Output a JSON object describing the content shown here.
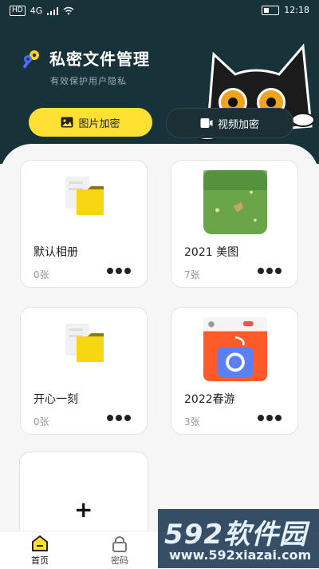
{
  "status_bar": {
    "network": "HD",
    "signal_text": "4G",
    "time": "12:18"
  },
  "header": {
    "title": "私密文件管理",
    "subtitle": "有效保护用户隐私"
  },
  "tabs": [
    {
      "label": "图片加密",
      "icon": "image-icon"
    },
    {
      "label": "视频加密",
      "icon": "video-icon"
    }
  ],
  "albums": [
    {
      "name": "默认相册",
      "count": "0张",
      "thumb": "folder-icon"
    },
    {
      "name": "2021 美图",
      "count": "7张",
      "thumb": "photo-grass"
    },
    {
      "name": "开心一刻",
      "count": "0张",
      "thumb": "folder-icon"
    },
    {
      "name": "2022春游",
      "count": "3张",
      "thumb": "photo-app-screen"
    }
  ],
  "add_album": {
    "symbol": "+"
  },
  "bottom_nav": [
    {
      "label": "首页",
      "icon": "home-icon",
      "active": true
    },
    {
      "label": "密码",
      "icon": "lock-icon",
      "active": false
    }
  ],
  "watermark": {
    "brand": "592软件园",
    "url": "www.592xiazai.com"
  },
  "colors": {
    "accent": "#ffe033",
    "header_bg": "#173239"
  }
}
